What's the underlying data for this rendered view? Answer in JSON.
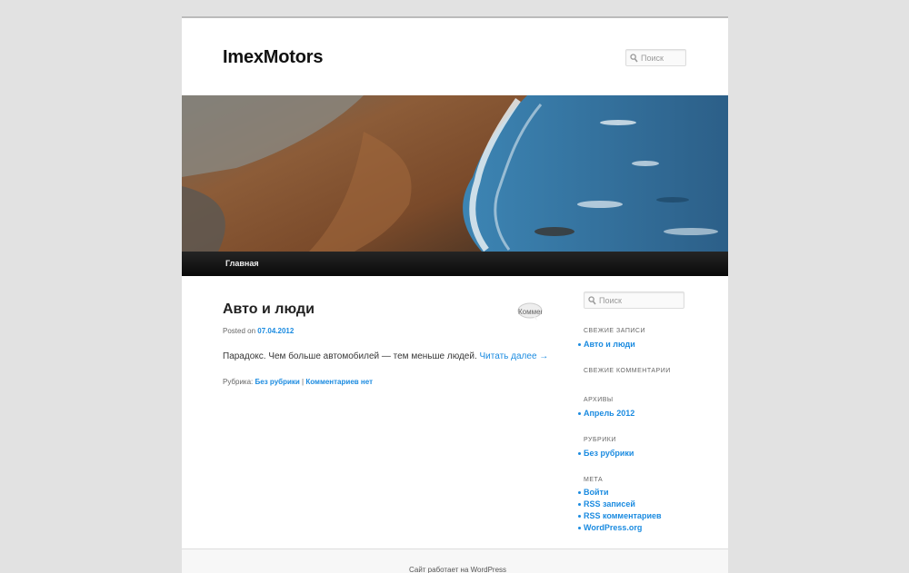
{
  "header": {
    "site_title": "ImexMotors",
    "search_placeholder": "Поиск"
  },
  "nav": {
    "items": [
      {
        "label": "Главная"
      }
    ]
  },
  "post": {
    "title": "Авто и люди",
    "comment_bubble": "Комментарии",
    "posted_on_label": "Posted on",
    "date": "07.04.2012",
    "excerpt": "Парадокс. Чем больше автомобилей — тем меньше людей.",
    "read_more": "Читать далее →",
    "category_label": "Рубрика:",
    "category": "Без рубрики",
    "separator": "|",
    "comments_link": "Комментариев нет"
  },
  "sidebar": {
    "search_placeholder": "Поиск",
    "recent_posts": {
      "title": "СВЕЖИЕ ЗАПИСИ",
      "items": [
        "Авто и люди"
      ]
    },
    "recent_comments": {
      "title": "СВЕЖИЕ КОММЕНТАРИИ"
    },
    "archives": {
      "title": "АРХИВЫ",
      "items": [
        "Апрель 2012"
      ]
    },
    "categories": {
      "title": "РУБРИКИ",
      "items": [
        "Без рубрики"
      ]
    },
    "meta": {
      "title": "МЕТА",
      "items": [
        "Войти",
        "RSS записей",
        "RSS комментариев",
        "WordPress.org"
      ]
    }
  },
  "footer": {
    "text": "Сайт работает на WordPress"
  },
  "colors": {
    "link": "#1b8be0",
    "nav_bg": "#111111",
    "page_bg": "#e2e2e2"
  }
}
